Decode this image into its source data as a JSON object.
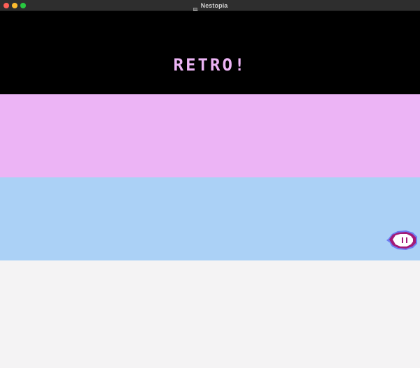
{
  "window": {
    "title": "Nestopia",
    "app_icon": "nestopia-icon",
    "controls": [
      "close",
      "minimize",
      "maximize"
    ],
    "colors": {
      "titlebar": "#2e2e2e",
      "close": "#ff5f57",
      "minimize": "#febc2e",
      "maximize": "#28c840"
    }
  },
  "game": {
    "headline": "RETRO!",
    "colors": {
      "band_black": "#000000",
      "band_pink": "#ecb4f5",
      "band_blue": "#abd1f6",
      "band_white": "#f4f3f4",
      "text": "#ecb4f5"
    },
    "sprite": "eye-creature-sprite"
  }
}
